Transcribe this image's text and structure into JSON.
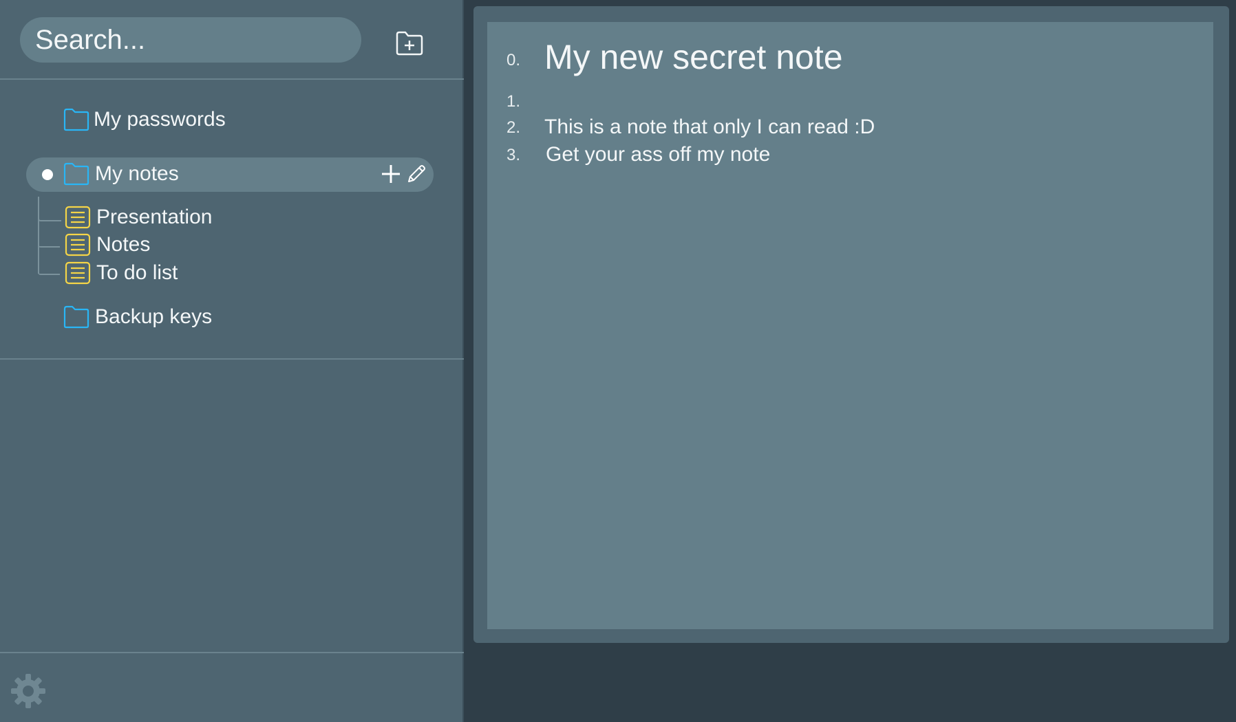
{
  "search": {
    "placeholder": "Search..."
  },
  "sidebar": {
    "new_folder_icon": "folder-plus-icon",
    "tree": {
      "folders": [
        {
          "label": "My passwords",
          "icon": "folder-icon"
        },
        {
          "label": "My notes",
          "icon": "folder-icon",
          "selected": true,
          "notes": [
            {
              "label": "Presentation",
              "icon": "note-icon"
            },
            {
              "label": "Notes",
              "icon": "note-icon"
            },
            {
              "label": "To do list",
              "icon": "note-icon"
            }
          ]
        },
        {
          "label": "Backup keys",
          "icon": "folder-icon"
        }
      ]
    },
    "row_actions": [
      "plus-icon",
      "pencil-icon"
    ],
    "settings_icon": "gear-icon"
  },
  "editor": {
    "lines": [
      {
        "number": "0.",
        "text": "My new secret note",
        "style": "heading"
      },
      {
        "number": "1.",
        "text": ""
      },
      {
        "number": "2.",
        "text": "This is a note that only I can read :D"
      },
      {
        "number": "3.",
        "text": "Get your ass off my note"
      }
    ]
  },
  "colors": {
    "background": "#2f3e48",
    "sidebar": "#4e6571",
    "editor": "#647f8a",
    "folder_icon": "#29b6f6",
    "note_icon": "#f5d547",
    "text": "#f4f7f8"
  }
}
